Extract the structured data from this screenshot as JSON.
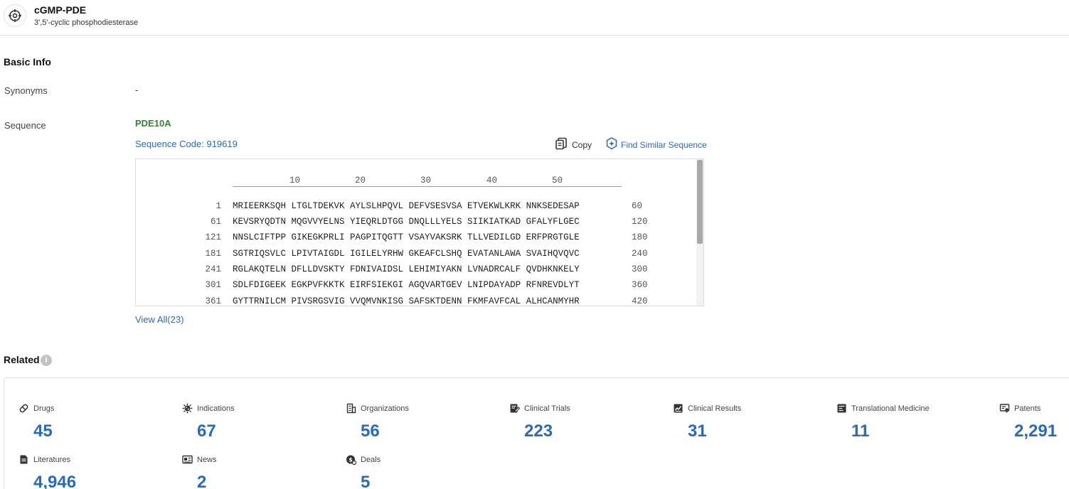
{
  "header": {
    "title": "cGMP-PDE",
    "subtitle": "3',5'-cyclic phosphodiesterase"
  },
  "basic_info": {
    "title": "Basic Info",
    "synonyms_label": "Synonyms",
    "synonyms_value": "-",
    "sequence_label": "Sequence",
    "gene": "PDE10A",
    "sequence_code": "Sequence Code: 919619",
    "copy_label": "Copy",
    "find_similar_label": "Find Similar Sequence",
    "ruler": [
      "10",
      "20",
      "30",
      "40",
      "50"
    ],
    "rows": [
      {
        "start": "1",
        "seq": "MRIEERKSQH LTGLTDEKVK AYLSLHPQVL DEFVSESVSA ETVEKWLKRK NNKSEDESAP",
        "end": "60"
      },
      {
        "start": "61",
        "seq": "KEVSRYQDTN MQGVVYELNS YIEQRLDTGG DNQLLLYELS SIIKIATKAD GFALYFLGEC",
        "end": "120"
      },
      {
        "start": "121",
        "seq": "NNSLCIFTPP GIKEGKPRLI PAGPITQGTT VSAYVAKSRK TLLVEDILGD ERFPRGTGLE",
        "end": "180"
      },
      {
        "start": "181",
        "seq": "SGTRIQSVLC LPIVTAIGDL IGILELYRHW GKEAFCLSHQ EVATANLAWA SVAIHQVQVC",
        "end": "240"
      },
      {
        "start": "241",
        "seq": "RGLAKQTELN DFLLDVSKTY FDNIVAIDSL LEHIMIYAKN LVNADRCALF QVDHKNKELY",
        "end": "300"
      },
      {
        "start": "301",
        "seq": "SDLFDIGEEK EGKPVFKKTK EIRFSIEKGI AGQVARTGEV LNIPDAYADP RFNREVDLYT",
        "end": "360"
      },
      {
        "start": "361",
        "seq": "GYTTRNILCM PIVSRGSVIG VVQMVNKISG SAFSKTDENN FKMFAVFCAL ALHCANMYHR",
        "end": "420"
      }
    ],
    "view_all": "View All(23)"
  },
  "related": {
    "title": "Related",
    "info_glyph": "i",
    "items": [
      {
        "id": "drugs",
        "label": "Drugs",
        "value": "45",
        "icon": "pill-icon"
      },
      {
        "id": "indications",
        "label": "Indications",
        "value": "67",
        "icon": "virus-icon"
      },
      {
        "id": "organizations",
        "label": "Organizations",
        "value": "56",
        "icon": "building-icon"
      },
      {
        "id": "clinical-trials",
        "label": "Clinical Trials",
        "value": "223",
        "icon": "clipboard-edit-icon"
      },
      {
        "id": "clinical-results",
        "label": "Clinical Results",
        "value": "31",
        "icon": "chart-doc-icon"
      },
      {
        "id": "translational-medicine",
        "label": "Translational Medicine",
        "value": "11",
        "icon": "flask-doc-icon"
      },
      {
        "id": "patents",
        "label": "Patents",
        "value": "2,291",
        "icon": "certificate-icon"
      },
      {
        "id": "literatures",
        "label": "Literatures",
        "value": "4,946",
        "icon": "document-icon"
      },
      {
        "id": "news",
        "label": "News",
        "value": "2",
        "icon": "newspaper-icon"
      },
      {
        "id": "deals",
        "label": "Deals",
        "value": "5",
        "icon": "deal-icon"
      }
    ]
  }
}
